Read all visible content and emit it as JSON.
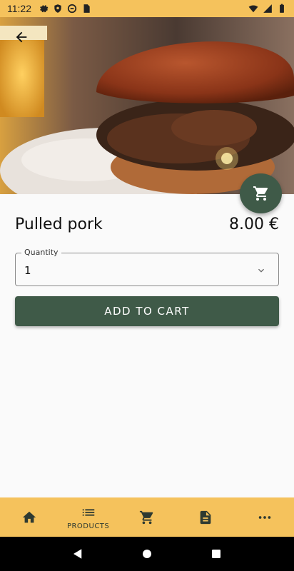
{
  "status_bar": {
    "time": "11:22",
    "left_icons": [
      "gear-icon",
      "shield-icon",
      "sync-icon",
      "sim-icon"
    ],
    "right_icons": [
      "wifi-icon",
      "signal-icon",
      "battery-icon"
    ],
    "background": "#f5c25c"
  },
  "hero": {
    "image": "pulled-pork-burger-photo",
    "back_icon": "arrow-back-icon"
  },
  "fab": {
    "icon": "cart-icon",
    "color": "#3f5a48"
  },
  "product": {
    "name": "Pulled pork",
    "price": "8.00 €"
  },
  "quantity": {
    "label": "Quantity",
    "value": "1"
  },
  "add_to_cart": {
    "label": "ADD TO CART",
    "color": "#3f5a48"
  },
  "bottom_nav": {
    "background": "#f5c25c",
    "items": [
      {
        "icon": "home-icon",
        "label": ""
      },
      {
        "icon": "list-icon",
        "label": "PRODUCTS"
      },
      {
        "icon": "cart-icon",
        "label": ""
      },
      {
        "icon": "document-icon",
        "label": ""
      },
      {
        "icon": "more-icon",
        "label": ""
      }
    ]
  },
  "system_nav": [
    "back-triangle-icon",
    "home-circle-icon",
    "recents-square-icon"
  ]
}
